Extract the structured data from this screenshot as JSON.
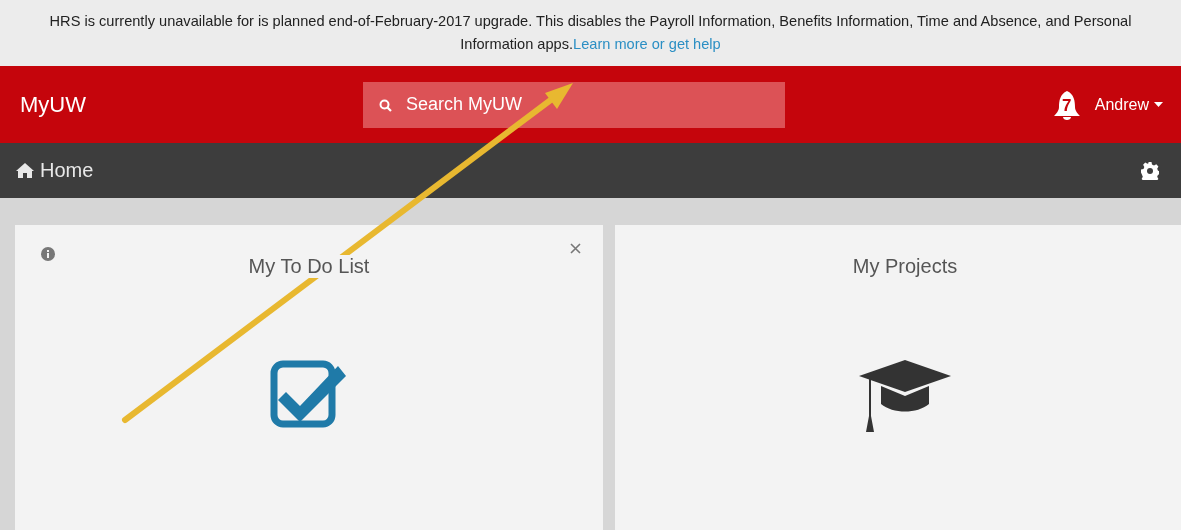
{
  "banner": {
    "message": "HRS is currently unavailable for is planned end-of-February-2017 upgrade. This disables the Payroll Information, Benefits Information, Time and Absence, and Personal Information apps.",
    "link": "Learn more or get help"
  },
  "header": {
    "brand": "MyUW",
    "search": {
      "placeholder": "Search MyUW"
    },
    "notifications": "7",
    "user": "Andrew"
  },
  "nav": {
    "title": "Home"
  },
  "cards": [
    {
      "title": "My To Do List",
      "kind": "todo"
    },
    {
      "title": "My Projects",
      "kind": "projects"
    }
  ]
}
